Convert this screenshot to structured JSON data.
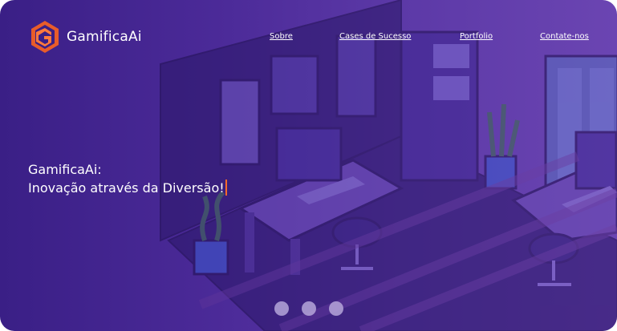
{
  "brand": {
    "name": "GamificaAi",
    "logo_icon": "gamificaai-logo-icon"
  },
  "nav": {
    "items": [
      {
        "label": "Sobre"
      },
      {
        "label": "Cases de Sucesso"
      },
      {
        "label": "Portfolio"
      },
      {
        "label": "Contate-nos"
      }
    ]
  },
  "hero": {
    "line1": "GamificaAi:",
    "line2": "Inovação através da Diversão!"
  },
  "carousel": {
    "slides": 3,
    "active_index": 0
  },
  "colors": {
    "bg_start": "#3a1f86",
    "bg_end": "#6b45b2",
    "accent": "#ff6a2a",
    "dot": "#b5a6d9"
  }
}
